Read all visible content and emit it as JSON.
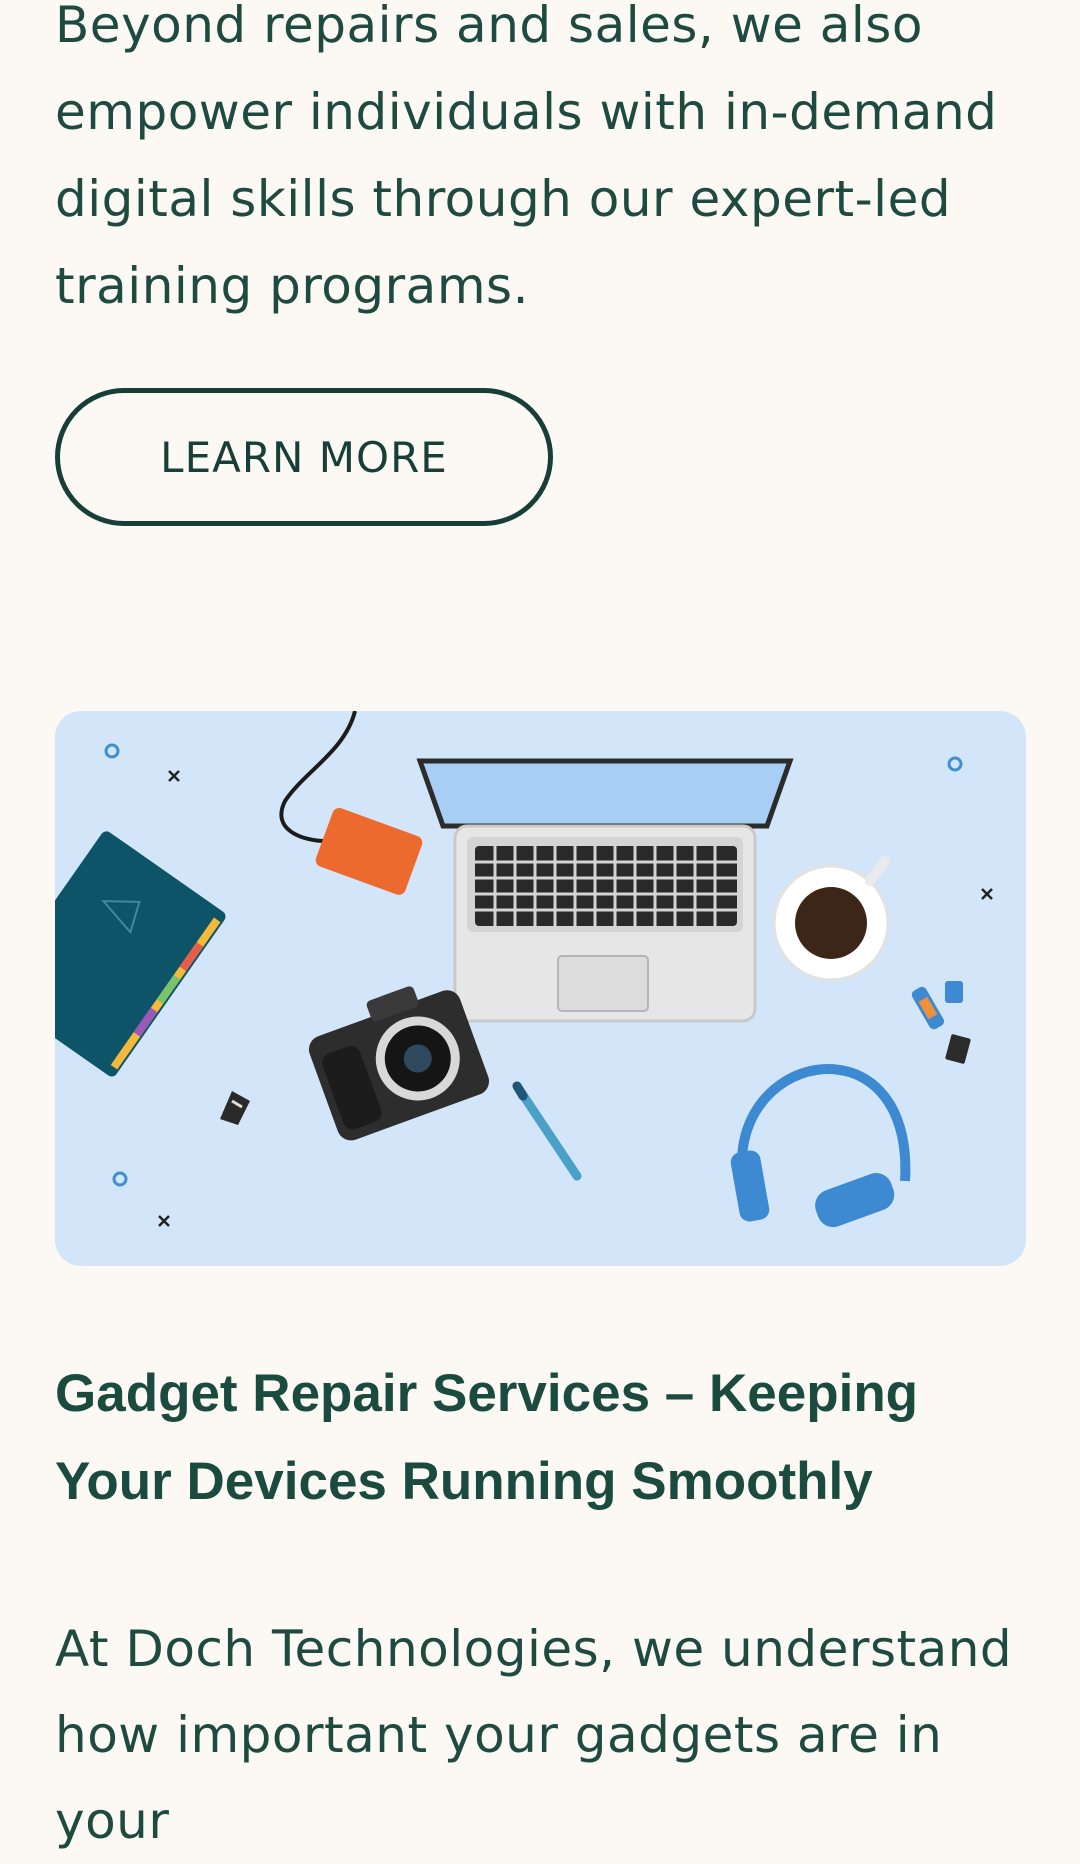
{
  "intro": {
    "text": "Beyond repairs and sales, we also empower individuals with in-demand digital skills through our expert-led training programs."
  },
  "cta": {
    "learn_more_label": "LEARN MORE"
  },
  "hero_image": {
    "items": [
      "notebook-icon",
      "external-drive-icon",
      "laptop-icon",
      "coffee-cup-icon",
      "camera-icon",
      "pen-icon",
      "headphones-icon",
      "usb-drive-icon",
      "sd-card-icon",
      "binder-clip-icon"
    ]
  },
  "section": {
    "title": "Gadget Repair Services – Keeping Your Devices Running Smoothly",
    "body": "At Doch Technologies, we understand how important your gadgets are in your"
  },
  "colors": {
    "background": "#fcf9f5",
    "text": "#1e4a40",
    "button_border": "#183f37",
    "hero_bg": "#d3e6f9"
  }
}
